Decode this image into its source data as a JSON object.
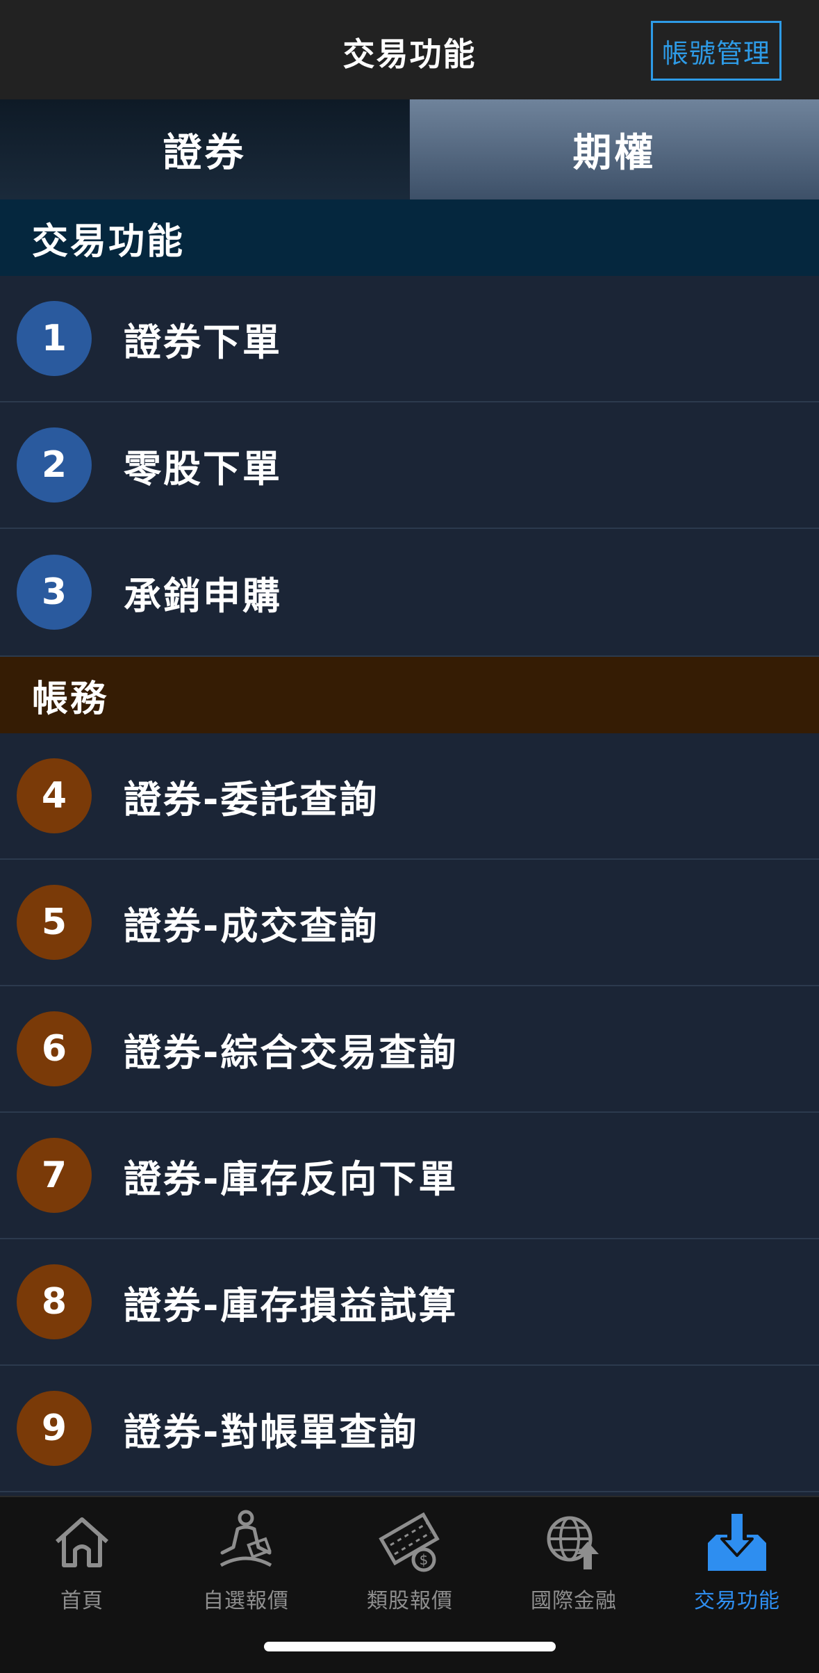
{
  "header": {
    "title": "交易功能",
    "account_button": "帳號管理"
  },
  "tabs": [
    {
      "label": "證券",
      "selected": true
    },
    {
      "label": "期權",
      "selected": false
    }
  ],
  "sections": {
    "trade": {
      "title": "交易功能",
      "items": [
        {
          "number": "1",
          "label": "證券下單"
        },
        {
          "number": "2",
          "label": "零股下單"
        },
        {
          "number": "3",
          "label": "承銷申購"
        }
      ]
    },
    "account": {
      "title": "帳務",
      "items": [
        {
          "number": "4",
          "label": "證券-委託查詢"
        },
        {
          "number": "5",
          "label": "證券-成交查詢"
        },
        {
          "number": "6",
          "label": "證券-綜合交易查詢"
        },
        {
          "number": "7",
          "label": "證券-庫存反向下單"
        },
        {
          "number": "8",
          "label": "證券-庫存損益試算"
        },
        {
          "number": "9",
          "label": "證券-對帳單查詢"
        }
      ]
    }
  },
  "bottom_nav": [
    {
      "label": "首頁",
      "icon": "home-icon"
    },
    {
      "label": "自選報價",
      "icon": "person-meditation-icon"
    },
    {
      "label": "類股報價",
      "icon": "film-coin-icon"
    },
    {
      "label": "國際金融",
      "icon": "globe-arrow-icon"
    },
    {
      "label": "交易功能",
      "icon": "download-tray-icon",
      "active": true
    }
  ],
  "colors": {
    "accent": "#2e8ef0",
    "trade_badge": "#2a5a9e",
    "account_badge": "#7a3a08",
    "trade_section_bg": "#05273e",
    "account_section_bg": "#351c04"
  }
}
